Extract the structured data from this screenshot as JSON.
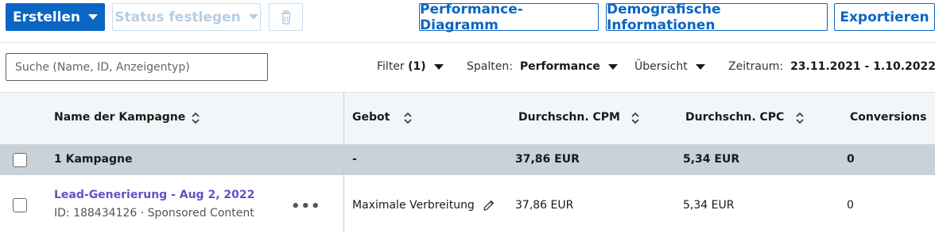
{
  "toolbar": {
    "create_label": "Erstellen",
    "status_label": "Status festlegen",
    "performance_label": "Performance-Diagramm",
    "demographics_label": "Demografische Informationen",
    "export_label": "Exportieren"
  },
  "filters": {
    "search_placeholder": "Suche (Name, ID, Anzeigentyp)",
    "filter_label": "Filter",
    "filter_count": "(1)",
    "columns_label": "Spalten:",
    "columns_value": "Performance",
    "overview_label": "Übersicht",
    "period_label": "Zeitraum:",
    "period_value": "23.11.2021 - 1.10.2022"
  },
  "table": {
    "headers": {
      "name": "Name der Kampagne",
      "bid": "Gebot",
      "cpm": "Durchschn. CPM",
      "cpc": "Durchschn. CPC",
      "conversions": "Conversions"
    },
    "summary": {
      "name": "1 Kampagne",
      "bid": "-",
      "cpm": "37,86 EUR",
      "cpc": "5,34 EUR",
      "conversions": "0"
    },
    "rows": [
      {
        "name": "Lead-Generierung - Aug 2, 2022",
        "meta": "ID: 188434126 · Sponsored Content",
        "bid": "Maximale Verbreitung",
        "cpm": "37,86 EUR",
        "cpc": "5,34 EUR",
        "conversions": "0"
      }
    ]
  },
  "colors": {
    "primary": "#0a66c2",
    "link": "#6a4fc8",
    "summary_bg": "#c9d2d9"
  }
}
